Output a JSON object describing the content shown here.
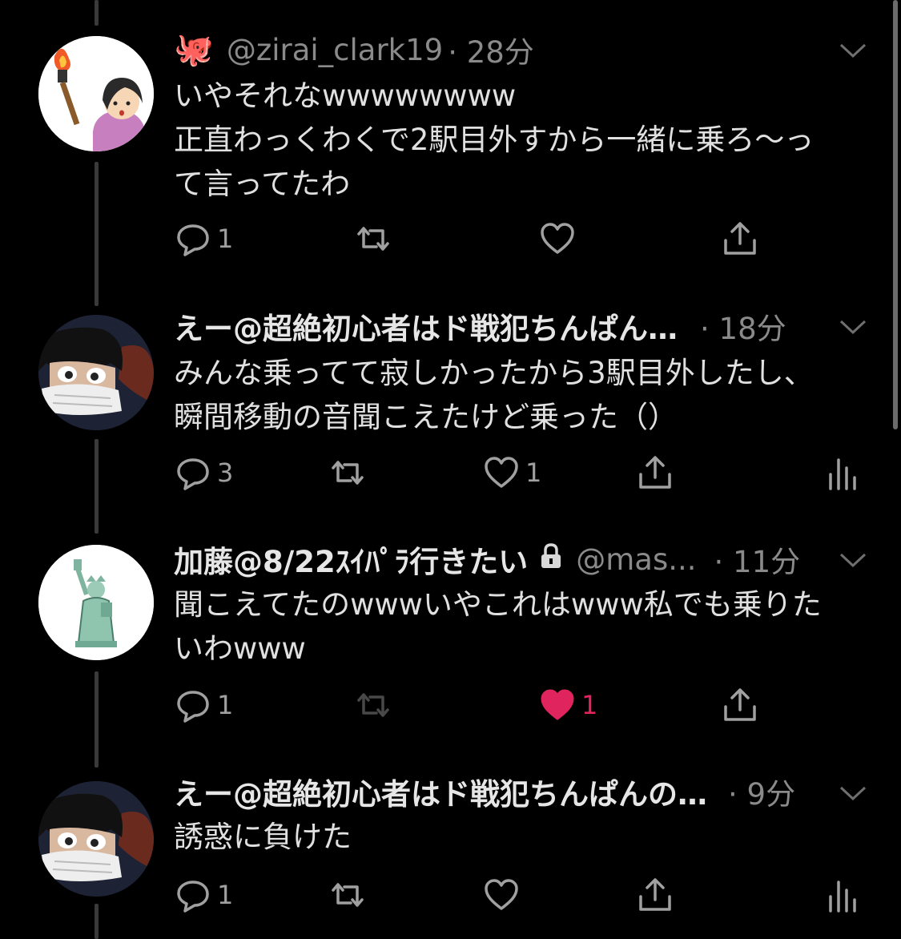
{
  "tweets": [
    {
      "emoji": "🐙",
      "name": "",
      "handle": "@zirai_clark19",
      "time": "· 28分",
      "lines": [
        "いやそれなwwwwwwww",
        "正直わっくわくで2駅目外すから一緒に乗ろ〜っ",
        "て言ってたわ"
      ],
      "reply_count": "1",
      "retweet_count": "",
      "like_count": "",
      "avatar": "person-with-torch-illustration"
    },
    {
      "name": "えー@超絶初心者はド戦犯ちんぱん…",
      "handle": "",
      "time": "· 18分",
      "lines": [
        "みんな乗ってて寂しかったから3駅目外したし、",
        "瞬間移動の音聞こえたけど乗った（）"
      ],
      "reply_count": "3",
      "retweet_count": "",
      "like_count": "1",
      "avatar": "anime-character-with-mask"
    },
    {
      "name": "加藤@8/22ｽｲﾊﾟﾗ行きたい",
      "handle": "@mas...",
      "time": "· 11分",
      "lines": [
        "聞こえてたのwwwいやこれはwww私でも乗りた",
        "いわwww"
      ],
      "reply_count": "1",
      "retweet_count": "",
      "like_count": "1",
      "liked": true,
      "locked": true,
      "avatar": "statue-of-liberty-illustration"
    },
    {
      "name": "えー@超絶初心者はド戦犯ちんぱんの…",
      "handle": "",
      "time": "· 9分",
      "lines": [
        "誘惑に負けた"
      ],
      "reply_count": "1",
      "retweet_count": "",
      "like_count": "",
      "avatar": "anime-character-with-mask"
    }
  ],
  "colors": {
    "background": "#000000",
    "text": "#e0e0e0",
    "muted": "#8a8a8a",
    "like": "#e0245e"
  },
  "icons": [
    "reply-icon",
    "retweet-icon",
    "like-icon",
    "share-icon",
    "analytics-icon",
    "chevron-down-icon",
    "lock-icon"
  ]
}
